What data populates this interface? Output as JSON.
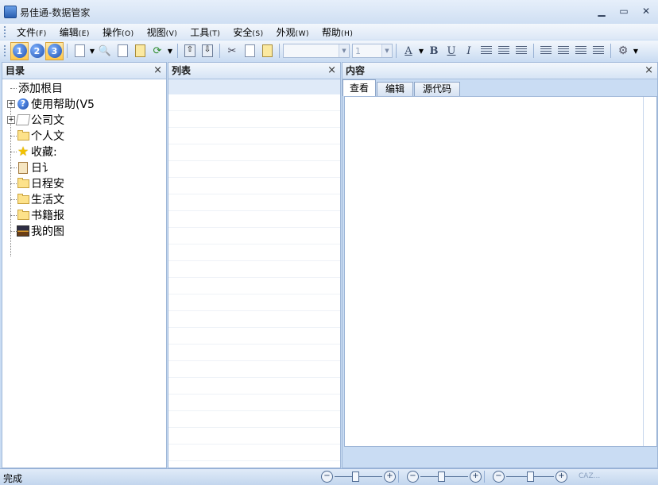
{
  "window": {
    "title": "易佳通-数据管家",
    "controls": {
      "minimize": "▁",
      "maximize": "▭",
      "close": "✕"
    }
  },
  "menu": [
    {
      "label": "文件",
      "accel": "(F)"
    },
    {
      "label": "编辑",
      "accel": "(E)"
    },
    {
      "label": "操作",
      "accel": "(O)"
    },
    {
      "label": "视图",
      "accel": "(V)"
    },
    {
      "label": "工具",
      "accel": "(T)"
    },
    {
      "label": "安全",
      "accel": "(S)"
    },
    {
      "label": "外观",
      "accel": "(W)"
    },
    {
      "label": "帮助",
      "accel": "(H)"
    }
  ],
  "toolbar": {
    "layout_buttons": [
      "1",
      "2",
      "3"
    ],
    "font_name": "",
    "font_size": "1",
    "format_labels": {
      "font_color": "A",
      "bold": "B",
      "underline": "U",
      "italic": "I"
    }
  },
  "tree_pane": {
    "title": "目录",
    "close": "×",
    "items": [
      {
        "label": "添加根目",
        "icon": "none-icon"
      },
      {
        "label": "使用帮助(V5",
        "icon": "help-icon",
        "expandable": true
      },
      {
        "label": "公司文",
        "icon": "note-icon",
        "expandable": true
      },
      {
        "label": "个人文",
        "icon": "folder-icon"
      },
      {
        "label": "收藏:",
        "icon": "star-icon"
      },
      {
        "label": "日讠",
        "icon": "clipboard-icon"
      },
      {
        "label": "日程安",
        "icon": "folder-icon"
      },
      {
        "label": "生活文",
        "icon": "folder-icon"
      },
      {
        "label": "书籍报",
        "icon": "folder-icon"
      },
      {
        "label": "我的图",
        "icon": "image-icon"
      }
    ]
  },
  "list_pane": {
    "title": "列表",
    "close": "×"
  },
  "content_pane": {
    "title": "内容",
    "close": "×",
    "tabs": [
      "查看",
      "编辑",
      "源代码"
    ],
    "active_tab": 0
  },
  "statusbar": {
    "text": "完成",
    "zoom_minus": "−",
    "zoom_plus": "+"
  },
  "watermark": "CAZ..."
}
